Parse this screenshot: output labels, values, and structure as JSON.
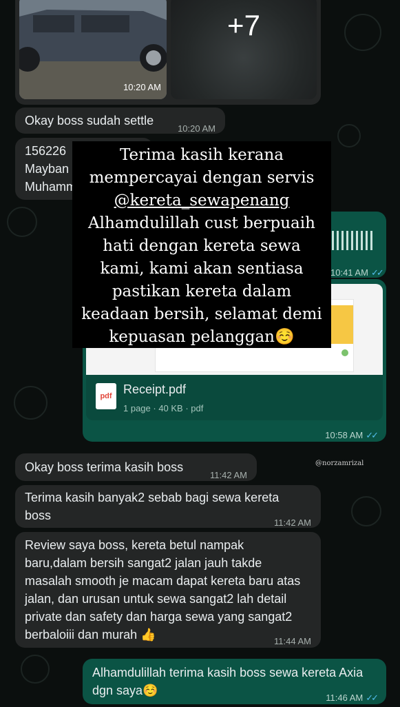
{
  "chat": {
    "photo_time": "10:20 AM",
    "more_photos": "+7",
    "msg1": {
      "text": "Okay boss sudah settle",
      "time": "10:20 AM"
    },
    "msg2": {
      "line1": "156226",
      "line2": "Mayban",
      "line3": "Muhamm"
    },
    "voice_time": "10:41 AM",
    "document": {
      "name": "Receipt.pdf",
      "meta": "1 page · 40 KB · pdf",
      "icon_label": "pdf",
      "time": "10:58 AM"
    },
    "msg3": {
      "text": "Okay boss terima kasih boss",
      "time": "11:42 AM"
    },
    "msg4": {
      "text": "Terima kasih banyak2 sebab bagi sewa kereta boss",
      "time": "11:42 AM"
    },
    "msg5": {
      "text": "Review saya boss, kereta betul nampak baru,dalam bersih sangat2 jalan jauh takde masalah smooth je macam dapat kereta baru atas jalan, dan urusan untuk sewa sangat2 lah detail private dan safety dan harga sewa yang sangat2 berbaloiii dan murah 👍",
      "time": "11:44 AM"
    },
    "msg6": {
      "text": "Alhamdulillah terima kasih boss sewa kereta Axia dgn saya☺️",
      "time": "11:46 AM"
    }
  },
  "overlay": {
    "line1": "Terima kasih kerana",
    "line2": "mempercayai dengan servis",
    "line3": "@kereta_sewapenang",
    "line4": "Alhamdulillah cust berpuaih",
    "line5": "hati dengan kereta sewa",
    "line6": "kami, kami akan sentiasa",
    "line7": "pastikan kereta dalam",
    "line8": "keadaan bersih, selamat demi",
    "line9": "kepuasan pelanggan☺️"
  },
  "watermark": "@norzamrizal",
  "colors": {
    "incoming": "#242626",
    "outgoing": "#0b5445",
    "read_ticks": "#53bdeb",
    "background": "#0b0f0e"
  }
}
